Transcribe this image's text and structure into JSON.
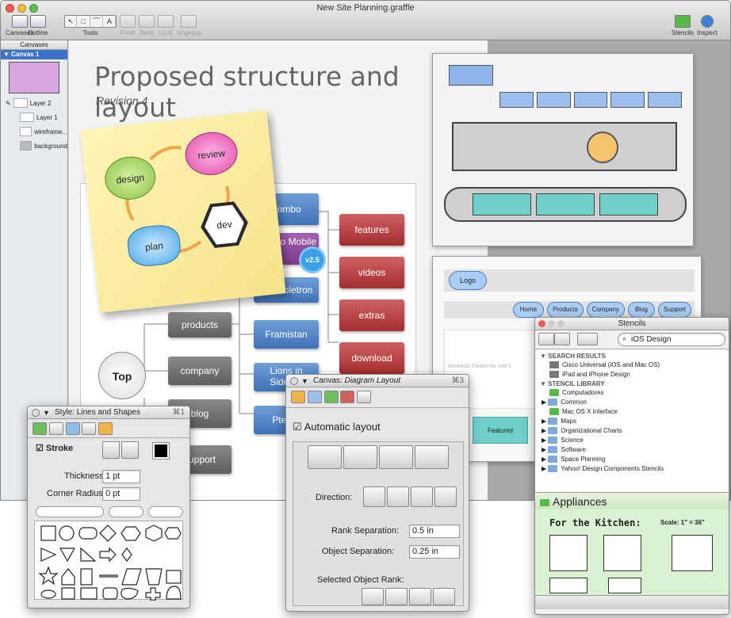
{
  "window": {
    "title": "New Site Planning.graffle"
  },
  "toolbar": {
    "canvases": "Canvases",
    "outline": "Outline",
    "tools": "Tools",
    "front": "Front",
    "back": "Back",
    "lock": "Lock",
    "ungroup": "Ungroup",
    "stencils": "Stencils",
    "inspect": "Inspect"
  },
  "sidebar": {
    "header": "Canvases",
    "canvas": "Canvas 1",
    "layers": [
      "Layer 2",
      "Layer 1",
      "wireframe...",
      "background"
    ]
  },
  "page": {
    "title": "Proposed structure and layout",
    "subtitle": "Revision 4"
  },
  "sticky": {
    "design": "design",
    "review": "review",
    "plan": "plan",
    "dev": "dev"
  },
  "diagram": {
    "root": "Top",
    "level1": [
      "products",
      "company",
      "blog",
      "support"
    ],
    "level2": [
      "Zombo",
      "Zombo Mobile",
      "Grumbletron",
      "Framistan",
      "Lions in Sidebar",
      "Pterod"
    ],
    "level3": [
      "features",
      "videos",
      "extras",
      "download"
    ],
    "badge": "v2.5"
  },
  "wireframe": {
    "logo": "Logo",
    "nav": [
      "Home",
      "Products",
      "Company",
      "Blog",
      "Support"
    ],
    "tagline": "Advanced Framistan that's",
    "featured": "Featured"
  },
  "style_panel": {
    "title": "Style: Lines and Shapes",
    "shortcut": "⌘1",
    "stroke": "Stroke",
    "thickness_label": "Thickness:",
    "thickness": "1 pt",
    "radius_label": "Corner Radius:",
    "radius": "0 pt"
  },
  "layout_panel": {
    "title_prefix": "Canvas:",
    "title": "Diagram Layout",
    "shortcut": "⌘3",
    "auto": "Automatic layout",
    "direction": "Direction:",
    "rank_label": "Rank Separation:",
    "rank": "0.5 in",
    "obj_label": "Object Separation:",
    "obj": "0.25 in",
    "selected": "Selected Object Rank:"
  },
  "stencils": {
    "title": "Stencils",
    "search": "iOS Design",
    "results_head": "SEARCH RESULTS",
    "results": [
      "Cisco Universal (iOS and Mac OS)",
      "iPad and iPhone Design"
    ],
    "library_head": "STENCIL LIBRARY",
    "library": [
      "Computadores",
      "Common",
      "Mac OS X Interface",
      "Maps",
      "Organizational Charts",
      "Science",
      "Software",
      "Space Planning",
      "Yahoo! Design Components Stencils"
    ],
    "group": "Appliances",
    "kitchen": "For the Kitchen:",
    "scale": "Scale: 1\" = 36\""
  }
}
